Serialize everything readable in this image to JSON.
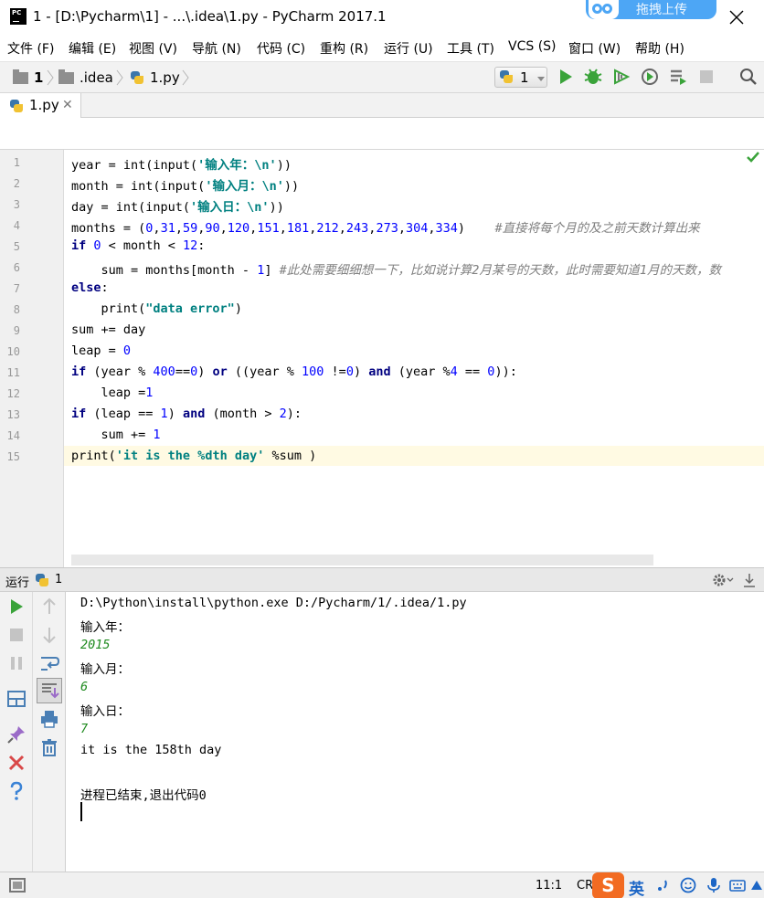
{
  "window": {
    "app_icon_text": "PC",
    "title": "1 - [D:\\Pycharm\\1] - ...\\.idea\\1.py - PyCharm 2017.1",
    "upload_badge": "拖拽上传"
  },
  "menu": [
    "文件 (F)",
    "编辑 (E)",
    "视图 (V)",
    "导航 (N)",
    "代码 (C)",
    "重构 (R)",
    "运行 (U)",
    "工具 (T)",
    "VCS (S)",
    "窗口 (W)",
    "帮助 (H)"
  ],
  "breadcrumb": [
    "1",
    ".idea",
    "1.py"
  ],
  "toolbar": {
    "run_config": "1",
    "icons": [
      "run-icon",
      "debug-icon",
      "coverage-icon",
      "profile-icon",
      "concurrency-icon",
      "stop-icon",
      "search-icon"
    ]
  },
  "editor_tab": {
    "label": "1.py",
    "close": "✕"
  },
  "editor": {
    "line_numbers": [
      "1",
      "2",
      "3",
      "4",
      "5",
      "6",
      "7",
      "8",
      "9",
      "10",
      "11",
      "12",
      "13",
      "14",
      "15"
    ],
    "current_line": 15,
    "lines": [
      "year = int(input('输入年：\\n'))",
      "month = int(input('输入月：\\n'))",
      "day = int(input('输入日：\\n'))",
      "months = (0,31,59,90,120,151,181,212,243,273,304,334)    #直接将每个月的及之前天数计算出来",
      "if 0 < month < 12:",
      "    sum = months[month - 1] #此处需要细细想一下，比如说计算2月某号的天数，此时需要知道1月的天数，数",
      "else:",
      "    print(\"data error\")",
      "sum += day",
      "leap = 0",
      "if (year % 400==0) or ((year % 100 !=0) and (year %4 == 0)):",
      "    leap =1",
      "if (leap == 1) and (month > 2):",
      "    sum += 1",
      "print('it is the %dth day' %sum )"
    ]
  },
  "run_panel": {
    "label": "运行",
    "config": "1",
    "console": [
      {
        "text": "D:\\Python\\install\\python.exe D:/Pycharm/1/.idea/1.py",
        "kind": "out"
      },
      {
        "text": "输入年：",
        "kind": "out"
      },
      {
        "text": "2015",
        "kind": "input"
      },
      {
        "text": "输入月：",
        "kind": "out"
      },
      {
        "text": "6",
        "kind": "input"
      },
      {
        "text": "输入日：",
        "kind": "out"
      },
      {
        "text": "7",
        "kind": "input"
      },
      {
        "text": "it is the 158th day",
        "kind": "out"
      },
      {
        "text": "",
        "kind": "out"
      },
      {
        "text": "进程已结束,退出代码0",
        "kind": "out"
      }
    ]
  },
  "statusbar": {
    "position": "11:1",
    "line_sep": "CR",
    "ime_logo": "S",
    "ime_lang": "英"
  },
  "colors": {
    "keyword": "#000080",
    "number": "#0000ff",
    "string": "#008080",
    "comment": "#808080",
    "console_input": "#1f8a1f",
    "current_line": "#fffae3"
  }
}
